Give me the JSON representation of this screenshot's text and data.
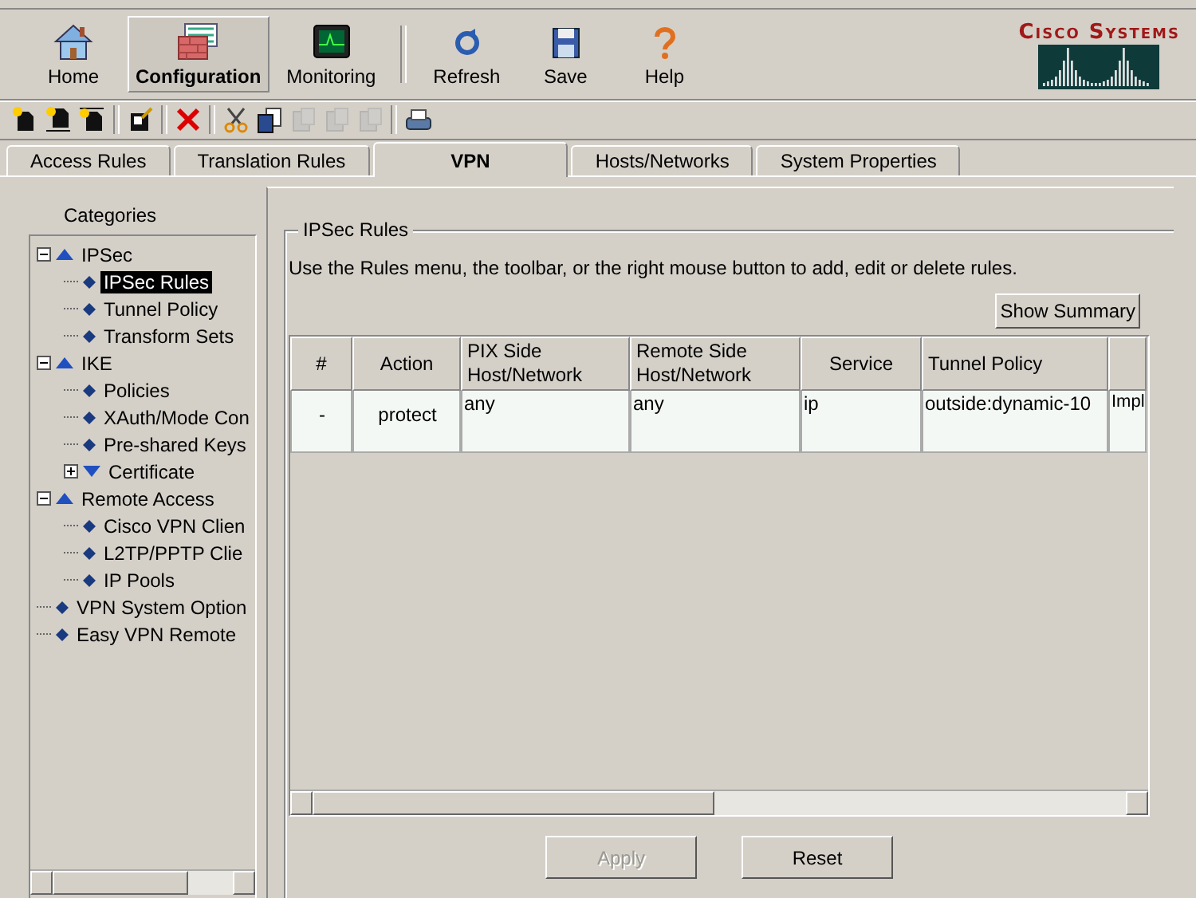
{
  "main_toolbar": [
    {
      "label": "Home",
      "kind": "home",
      "selected": false
    },
    {
      "label": "Configuration",
      "kind": "configuration",
      "selected": true
    },
    {
      "label": "Monitoring",
      "kind": "monitoring",
      "selected": false
    },
    {
      "kind": "separator"
    },
    {
      "label": "Refresh",
      "kind": "refresh",
      "selected": false
    },
    {
      "label": "Save",
      "kind": "save",
      "selected": false
    },
    {
      "label": "Help",
      "kind": "help",
      "selected": false
    }
  ],
  "logo": {
    "text": "Cisco Systems"
  },
  "edit_toolbar": [
    {
      "kind": "add",
      "disabled": false
    },
    {
      "kind": "insert-before",
      "disabled": false
    },
    {
      "kind": "insert-after",
      "disabled": false
    },
    {
      "kind": "separator"
    },
    {
      "kind": "edit",
      "disabled": false
    },
    {
      "kind": "separator"
    },
    {
      "kind": "delete",
      "disabled": false
    },
    {
      "kind": "separator"
    },
    {
      "kind": "cut",
      "disabled": false
    },
    {
      "kind": "copy",
      "disabled": false
    },
    {
      "kind": "paste",
      "disabled": true
    },
    {
      "kind": "paste",
      "disabled": true
    },
    {
      "kind": "paste",
      "disabled": true
    },
    {
      "kind": "separator"
    },
    {
      "kind": "print",
      "disabled": false
    }
  ],
  "tabs": [
    {
      "label": "Access Rules",
      "selected": false
    },
    {
      "label": "Translation Rules",
      "selected": false
    },
    {
      "label": "VPN",
      "selected": true
    },
    {
      "label": "Hosts/Networks",
      "selected": false
    },
    {
      "label": "System Properties",
      "selected": false
    }
  ],
  "sidebar": {
    "title": "Categories",
    "tree": [
      {
        "label": "IPSec",
        "kind": "group",
        "expanded": true,
        "selected": false,
        "children": [
          {
            "label": "IPSec Rules",
            "kind": "leaf",
            "selected": true
          },
          {
            "label": "Tunnel Policy",
            "kind": "leaf",
            "selected": false
          },
          {
            "label": "Transform Sets",
            "kind": "leaf",
            "selected": false
          }
        ]
      },
      {
        "label": "IKE",
        "kind": "group",
        "expanded": true,
        "selected": false,
        "children": [
          {
            "label": "Policies",
            "kind": "leaf",
            "selected": false
          },
          {
            "label": "XAuth/Mode Con",
            "kind": "leaf",
            "selected": false
          },
          {
            "label": "Pre-shared Keys",
            "kind": "leaf",
            "selected": false
          },
          {
            "label": "Certificate",
            "kind": "group",
            "expanded": false,
            "selected": false
          }
        ]
      },
      {
        "label": "Remote Access",
        "kind": "group",
        "expanded": true,
        "selected": false,
        "children": [
          {
            "label": "Cisco VPN Clien",
            "kind": "leaf",
            "selected": false
          },
          {
            "label": "L2TP/PPTP Clie",
            "kind": "leaf",
            "selected": false
          },
          {
            "label": "IP Pools",
            "kind": "leaf",
            "selected": false
          }
        ]
      },
      {
        "label": "VPN System Option",
        "kind": "leaf",
        "selected": false
      },
      {
        "label": "Easy VPN Remote",
        "kind": "leaf",
        "selected": false
      }
    ]
  },
  "panel": {
    "title": "IPSec Rules",
    "instructions": "Use the Rules menu, the toolbar, or the right mouse button to add, edit or delete rules.",
    "summary_button": "Show Summary",
    "table": {
      "columns": [
        "#",
        "Action",
        "PIX Side Host/Network",
        "Remote Side Host/Network",
        "Service",
        "Tunnel Policy",
        ""
      ],
      "rows": [
        [
          "-",
          "protect",
          "any",
          "any",
          "ip",
          "outside:dynamic-10",
          "Impl"
        ]
      ]
    },
    "buttons": [
      {
        "label": "Apply",
        "disabled": true
      },
      {
        "label": "Reset",
        "disabled": false
      }
    ]
  }
}
